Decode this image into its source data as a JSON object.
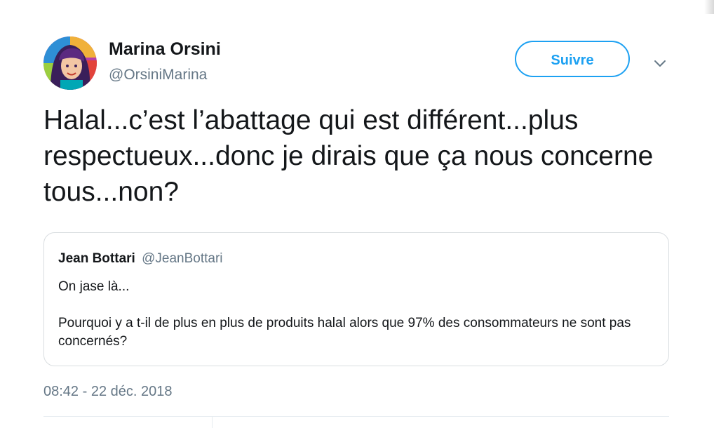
{
  "tweet": {
    "author": {
      "name": "Marina Orsini",
      "handle": "@OrsiniMarina",
      "avatar": "avatar-portrait"
    },
    "follow_label": "Suivre",
    "menu_icon": "chevron-down-icon",
    "text": "Halal...c’est l’abattage qui est différent...plus respectueux...donc je dirais que ça nous concerne tous...non?",
    "timestamp": "08:42 - 22 déc. 2018"
  },
  "quoted_tweet": {
    "name": "Jean Bottari",
    "handle": "@JeanBottari",
    "line1": "On jase là...",
    "line2": "Pourquoi y a t-il de plus en plus de produits halal alors que 97% des consommateurs ne sont pas concernés?"
  },
  "colors": {
    "accent": "#1da1f2",
    "text_primary": "#14171a",
    "text_secondary": "#657786",
    "border": "#d9dde0"
  }
}
